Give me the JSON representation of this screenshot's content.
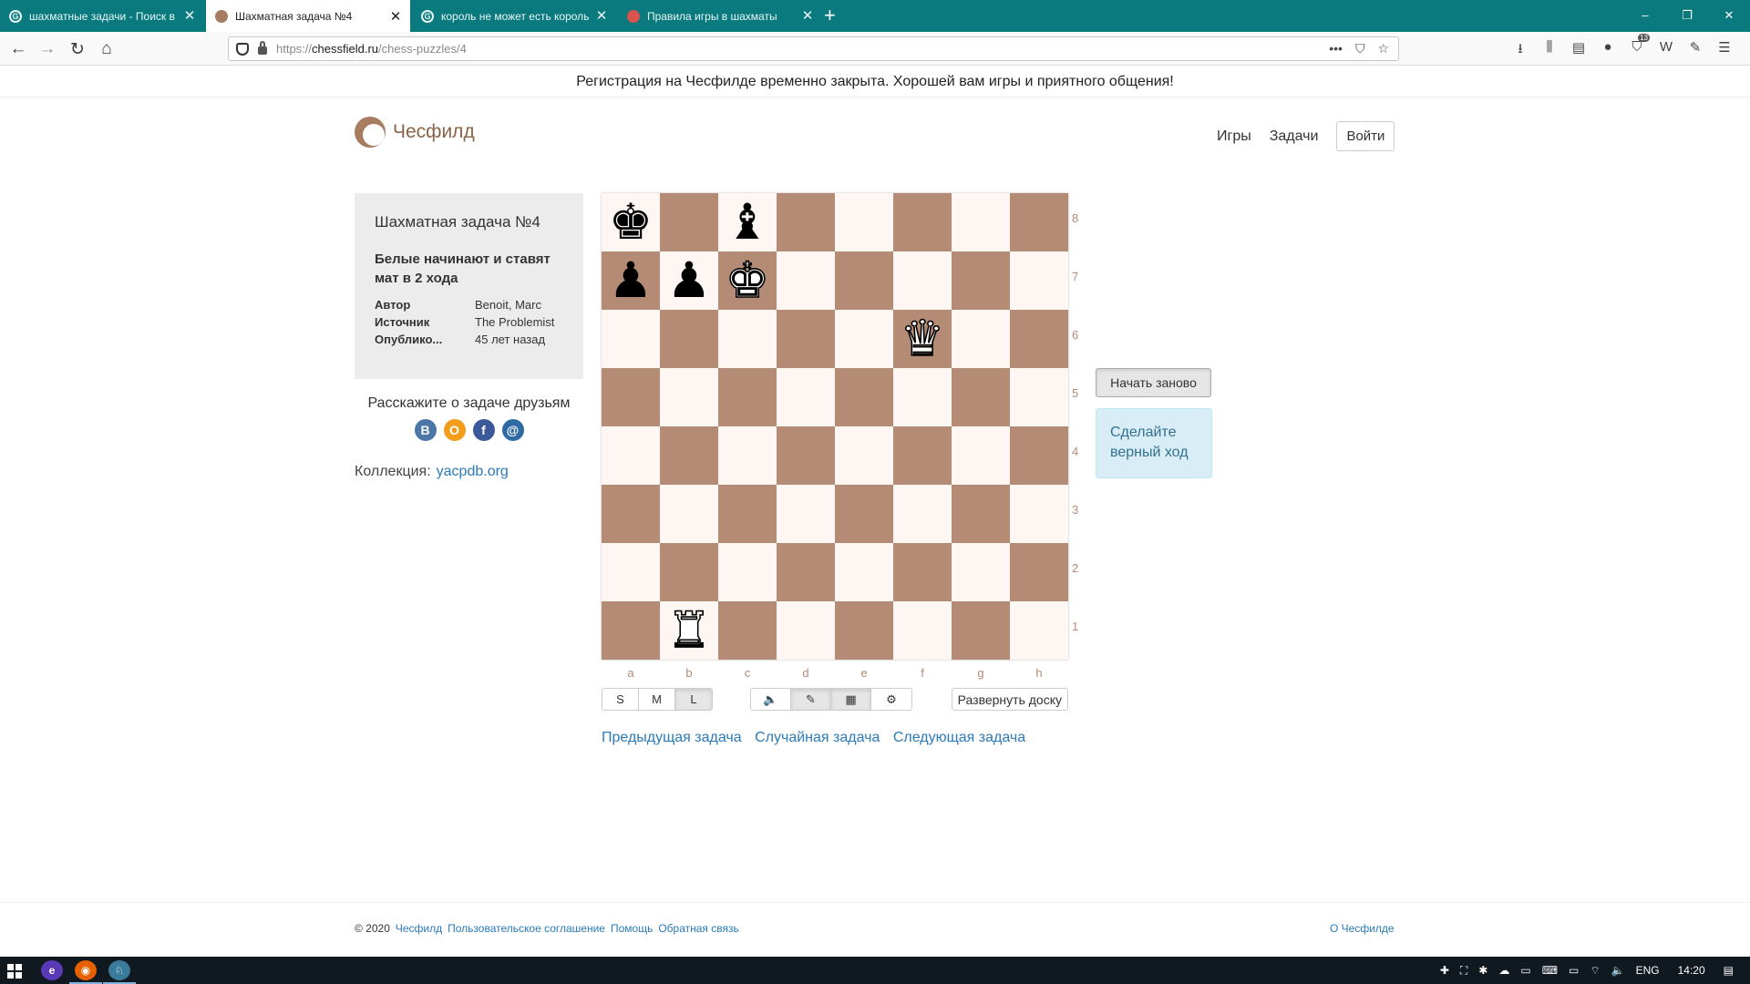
{
  "browser": {
    "tabs": [
      {
        "title": "шахматные задачи - Поиск в",
        "favicon": "G",
        "favicon_color": "#e8f6f6",
        "active": false
      },
      {
        "title": "Шахматная задача №4",
        "favicon": "",
        "favicon_color": "#a77c60",
        "active": true
      },
      {
        "title": "король не может есть король",
        "favicon": "G",
        "favicon_color": "#e8f6f6",
        "active": false
      },
      {
        "title": "Правила игры в шахматы",
        "favicon": "",
        "favicon_color": "#d9534f",
        "active": false
      }
    ],
    "new_tab": "+",
    "window_controls": [
      "–",
      "❐",
      "✕"
    ],
    "url_prefix": "https://",
    "url_host": "chessfield.ru",
    "url_path": "/chess-puzzles/4",
    "url_icons": [
      "•••",
      "⛉",
      "☆"
    ],
    "toolbar_icons": [
      "⭳",
      "⫼",
      "▤",
      "●",
      "⛉",
      "W",
      "✎",
      "☰"
    ],
    "extension_badge": "13",
    "nav_icons": {
      "back": "←",
      "forward": "→",
      "reload": "↻",
      "home": "⌂"
    }
  },
  "notice": "Регистрация на Чесфилде временно закрыта. Хорошей вам игры и приятного общения!",
  "header": {
    "logo_text": "Чесфилд",
    "nav": [
      "Игры",
      "Задачи"
    ],
    "login": "Войти"
  },
  "puzzle": {
    "title": "Шахматная задача №4",
    "goal": "Белые начинают и ставят мат в 2 хода",
    "meta": [
      {
        "key": "Автор",
        "value": "Benoit, Marc"
      },
      {
        "key": "Источник",
        "value": "The Problemist"
      },
      {
        "key": "Опублико...",
        "value": "45 лет назад"
      }
    ]
  },
  "share": {
    "label": "Расскажите о задаче друзьям",
    "icons": [
      {
        "name": "vk-icon",
        "glyph": "В",
        "color": "#4a76a8"
      },
      {
        "name": "odnoklassniki-icon",
        "glyph": "О",
        "color": "#f49d1b"
      },
      {
        "name": "facebook-icon",
        "glyph": "f",
        "color": "#3b5998"
      },
      {
        "name": "mailru-icon",
        "glyph": "@",
        "color": "#2f6aa5"
      }
    ]
  },
  "collection": {
    "label": "Коллекция:",
    "link": "yacpdb.org"
  },
  "board": {
    "files": [
      "a",
      "b",
      "c",
      "d",
      "e",
      "f",
      "g",
      "h"
    ],
    "ranks": [
      "8",
      "7",
      "6",
      "5",
      "4",
      "3",
      "2",
      "1"
    ],
    "pieces": [
      {
        "square": "a8",
        "piece": "king",
        "color": "black"
      },
      {
        "square": "c8",
        "piece": "bishop",
        "color": "black"
      },
      {
        "square": "a7",
        "piece": "pawn",
        "color": "black"
      },
      {
        "square": "b7",
        "piece": "pawn",
        "color": "black"
      },
      {
        "square": "c7",
        "piece": "king",
        "color": "white"
      },
      {
        "square": "f6",
        "piece": "queen",
        "color": "white"
      },
      {
        "square": "b1",
        "piece": "rook",
        "color": "white"
      }
    ],
    "light_color": "#fdf6f2",
    "dark_color": "#b48b74"
  },
  "controls": {
    "sizes": [
      "S",
      "M",
      "L"
    ],
    "active_size": "L",
    "tools": [
      {
        "name": "sound-icon",
        "glyph": "🔈",
        "on": false
      },
      {
        "name": "pen-icon",
        "glyph": "✎",
        "on": true
      },
      {
        "name": "grid-icon",
        "glyph": "▦",
        "on": true
      },
      {
        "name": "settings-icon",
        "glyph": "⚙",
        "on": false
      }
    ],
    "expand": "Развернуть доску"
  },
  "puzzle_nav": [
    "Предыдущая задача",
    "Случайная задача",
    "Следующая задача"
  ],
  "actions": {
    "restart": "Начать заново",
    "hint": "Сделайте верный ход"
  },
  "footer": {
    "copyright": "© 2020",
    "links": [
      "Чесфилд",
      "Пользовательское соглашение",
      "Помощь",
      "Обратная связь"
    ],
    "about": "О Чесфилде"
  },
  "taskbar": {
    "apps": [
      {
        "name": "edge-icon",
        "glyph": "e",
        "color": "#5b3ab8",
        "open": false
      },
      {
        "name": "firefox-icon",
        "glyph": "◉",
        "color": "#e66000",
        "open": true
      },
      {
        "name": "chess-app-icon",
        "glyph": "♘",
        "color": "#3a7a9a",
        "open": true
      }
    ],
    "tray_icons": [
      "✚",
      "⛶",
      "✱",
      "☁",
      "▭",
      "⌨",
      "▭",
      "⌔",
      "🔈"
    ],
    "lang": "ENG",
    "time": "14:20",
    "notif": "▤"
  }
}
